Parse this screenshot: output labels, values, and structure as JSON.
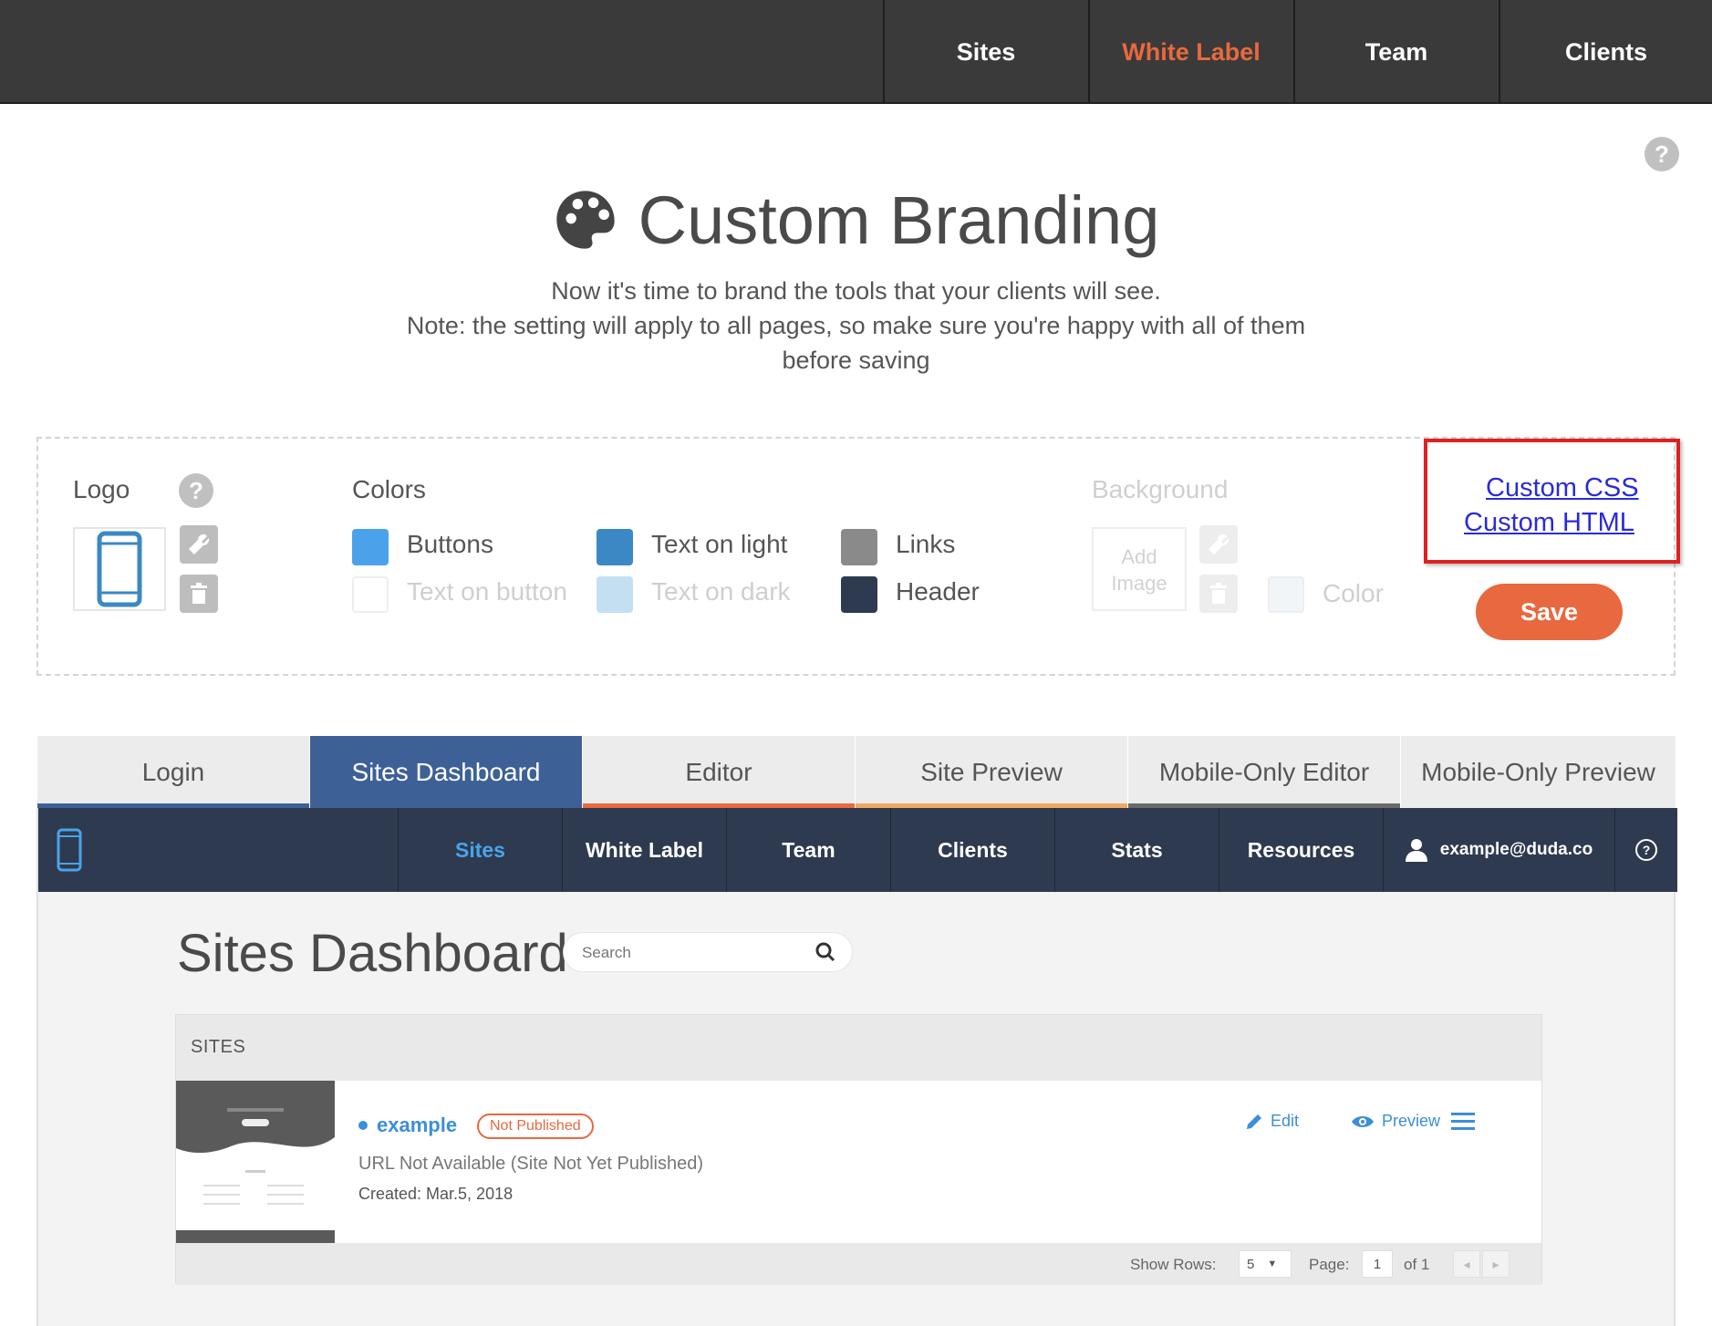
{
  "topnav": {
    "items": [
      {
        "label": "Sites"
      },
      {
        "label": "White Label",
        "active": true
      },
      {
        "label": "Team"
      },
      {
        "label": "Clients"
      }
    ],
    "active_color": "#e8693f"
  },
  "help_icon": "question-circle-icon",
  "page": {
    "title": "Custom Branding",
    "title_icon": "palette-icon",
    "subtitle_line1": "Now it's time to brand the tools that your clients will see.",
    "subtitle_line2": "Note: the setting will apply to all pages, so make sure you're happy with all of them before saving"
  },
  "branding": {
    "logo_label": "Logo",
    "colors_label": "Colors",
    "colors": [
      {
        "label": "Buttons",
        "color": "#4aa3ea"
      },
      {
        "label": "Text on light",
        "color": "#3c88c4"
      },
      {
        "label": "Links",
        "color": "#8a8a8a"
      },
      {
        "label": "Text on button",
        "color": "#ffffff",
        "muted": true
      },
      {
        "label": "Text on dark",
        "color": "#c5dff2",
        "muted": true
      },
      {
        "label": "Header",
        "color": "#2e3a4f"
      }
    ],
    "background_label": "Background",
    "add_image_line1": "Add",
    "add_image_line2": "Image",
    "color_label": "Color",
    "custom_css_link": "Custom CSS",
    "custom_html_link": "Custom HTML",
    "save_label": "Save"
  },
  "tabs": [
    {
      "label": "Login",
      "underline": "#3d6196"
    },
    {
      "label": "Sites Dashboard",
      "active": true,
      "underline": "#3d6196"
    },
    {
      "label": "Editor",
      "underline": "#e8693f"
    },
    {
      "label": "Site Preview",
      "underline": "#f0a860"
    },
    {
      "label": "Mobile-Only Editor",
      "underline": "#6a6a6a"
    },
    {
      "label": "Mobile-Only Preview",
      "underline": "#6a6a6a"
    }
  ],
  "preview": {
    "nav": {
      "items": [
        "Sites",
        "White Label",
        "Team",
        "Clients",
        "Stats",
        "Resources"
      ],
      "user_email": "example@duda.co"
    },
    "title": "Sites Dashboard",
    "search_placeholder": "Search",
    "sites_header": "SITES",
    "site": {
      "name": "example",
      "status": "Not Published",
      "url": "URL Not Available (Site Not Yet Published)",
      "created": "Created: Mar.5, 2018",
      "edit_label": "Edit",
      "preview_label": "Preview"
    },
    "footer": {
      "show_rows_label": "Show Rows:",
      "show_rows_value": "5",
      "page_label": "Page:",
      "page_value": "1",
      "of_label": "of 1"
    }
  }
}
